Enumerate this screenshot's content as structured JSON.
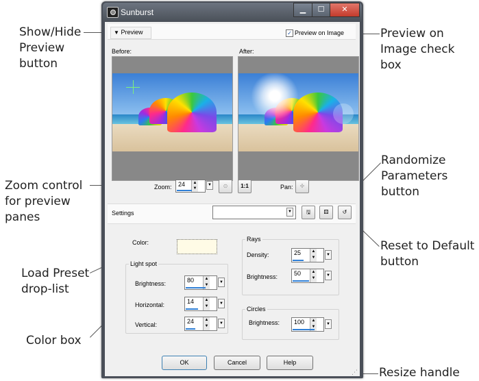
{
  "window": {
    "title": "Sunburst"
  },
  "preview_toggle": {
    "label": "Preview",
    "expanded": true
  },
  "preview_on_image": {
    "label": "Preview on Image",
    "checked": true
  },
  "panes": {
    "before_label": "Before:",
    "after_label": "After:"
  },
  "zoom": {
    "label": "Zoom:",
    "value": "24",
    "reset_label": "1:1"
  },
  "pan": {
    "label": "Pan:"
  },
  "settings": {
    "label": "Settings",
    "preset_value": ""
  },
  "color": {
    "label": "Color:",
    "value": "#fffbe6"
  },
  "light_spot": {
    "title": "Light spot",
    "brightness_label": "Brightness:",
    "brightness": "80",
    "horizontal_label": "Horizontal:",
    "horizontal": "14",
    "vertical_label": "Vertical:",
    "vertical": "24"
  },
  "rays": {
    "title": "Rays",
    "density_label": "Density:",
    "density": "25",
    "brightness_label": "Brightness:",
    "brightness": "50"
  },
  "circles": {
    "title": "Circles",
    "brightness_label": "Brightness:",
    "brightness": "100"
  },
  "buttons": {
    "ok": "OK",
    "cancel": "Cancel",
    "help": "Help"
  },
  "callouts": {
    "show_hide": [
      "Show/Hide",
      "Preview",
      "button"
    ],
    "preview_on_image": [
      "Preview on",
      "Image check",
      "box"
    ],
    "zoom": [
      "Zoom control",
      "for preview",
      "panes"
    ],
    "randomize": [
      "Randomize",
      "Parameters",
      "button"
    ],
    "reset": [
      "Reset to Default",
      "button"
    ],
    "load_preset": [
      "Load Preset",
      "drop-list"
    ],
    "color_box": [
      "Color box"
    ],
    "resize": [
      "Resize handle"
    ]
  },
  "colors": {
    "accent": "#2f7fd6",
    "frame": "#4a4f58",
    "client": "#f0f0f0"
  },
  "icons": [
    "camera-icon",
    "minimize-icon",
    "maximize-icon",
    "close-icon",
    "triangle-down-icon",
    "checkmark-icon",
    "zoom-fit-icon",
    "pan-icon",
    "save-preset-icon",
    "randomize-dice-icon",
    "reset-icon",
    "resize-grip-icon"
  ]
}
